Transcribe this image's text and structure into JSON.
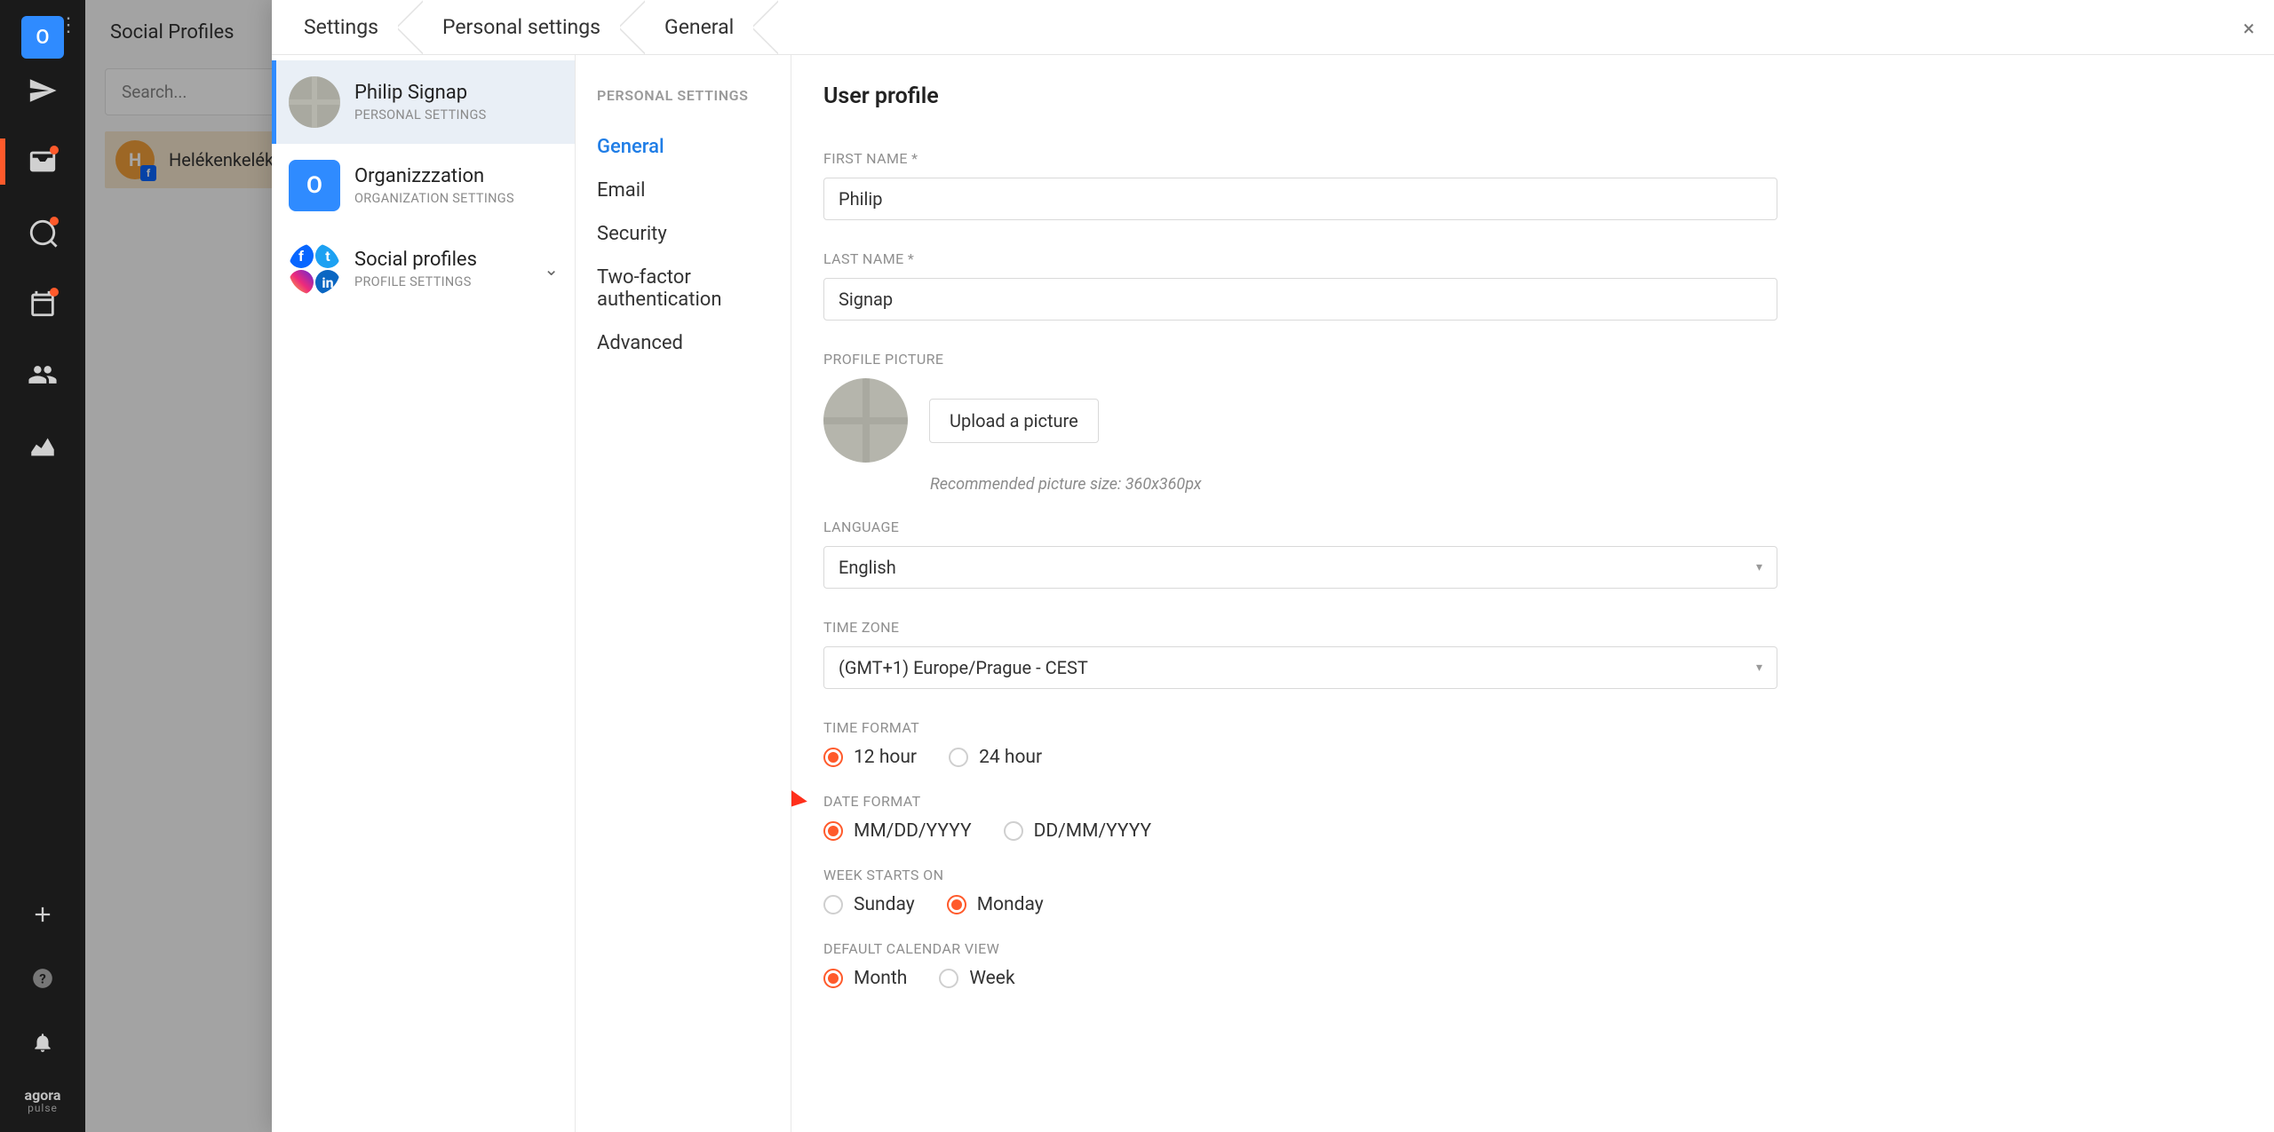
{
  "rail": {
    "workspace_initial": "O",
    "logo_name": "agora",
    "logo_sub": "pulse"
  },
  "bg": {
    "title": "Social Profiles",
    "search_placeholder": "Search...",
    "profile_initial": "H",
    "profile_label": "Helékenkeléke"
  },
  "breadcrumb": {
    "a": "Settings",
    "b": "Personal settings",
    "c": "General"
  },
  "accounts": [
    {
      "title": "Philip Signap",
      "sub": "PERSONAL SETTINGS"
    },
    {
      "title": "Organizzzation",
      "sub": "ORGANIZATION SETTINGS",
      "initial": "O"
    },
    {
      "title": "Social profiles",
      "sub": "PROFILE SETTINGS"
    }
  ],
  "sections": {
    "head": "PERSONAL SETTINGS",
    "items": [
      "General",
      "Email",
      "Security",
      "Two-factor authentication",
      "Advanced"
    ],
    "active": 0
  },
  "form": {
    "title": "User profile",
    "first_name_label": "FIRST NAME *",
    "first_name": "Philip",
    "last_name_label": "LAST NAME *",
    "last_name": "Signap",
    "pp_label": "PROFILE PICTURE",
    "upload_label": "Upload a picture",
    "pp_hint": "Recommended picture size: 360x360px",
    "language_label": "LANGUAGE",
    "language": "English",
    "tz_label": "TIME ZONE",
    "tz": "(GMT+1) Europe/Prague - CEST",
    "time_format_label": "TIME FORMAT",
    "time_format_opts": [
      "12 hour",
      "24 hour"
    ],
    "time_format_selected": 0,
    "date_format_label": "DATE FORMAT",
    "date_format_opts": [
      "MM/DD/YYYY",
      "DD/MM/YYYY"
    ],
    "date_format_selected": 0,
    "week_start_label": "WEEK STARTS ON",
    "week_start_opts": [
      "Sunday",
      "Monday"
    ],
    "week_start_selected": 1,
    "cal_view_label": "DEFAULT CALENDAR VIEW",
    "cal_view_opts": [
      "Month",
      "Week"
    ],
    "cal_view_selected": 0
  }
}
